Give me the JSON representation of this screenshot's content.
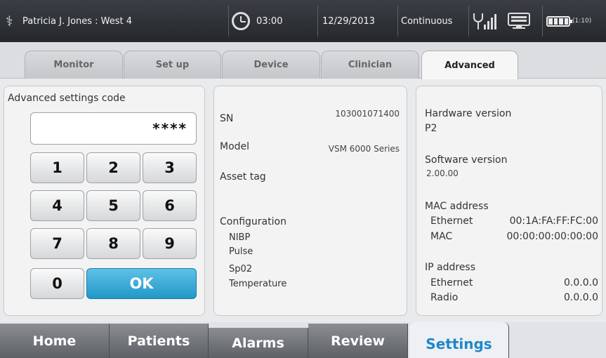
{
  "status_bar": {
    "patient": "Patricia J. Jones : West 4",
    "timer": "03:00",
    "date": "12/29/2013",
    "mode": "Continuous",
    "battery_time": "(1:10)",
    "icons": [
      "caduceus-icon",
      "clock-icon",
      "antenna-signal-icon",
      "monitor-icon",
      "battery-icon"
    ]
  },
  "top_tabs": [
    "Monitor",
    "Set up",
    "Device",
    "Clinician",
    "Advanced"
  ],
  "active_top_tab": "Advanced",
  "keypad": {
    "title": "Advanced settings code",
    "code_value": "****",
    "keys": [
      "1",
      "2",
      "3",
      "4",
      "5",
      "6",
      "7",
      "8",
      "9",
      "0"
    ],
    "ok_label": "OK"
  },
  "device_info": {
    "sn_label": "SN",
    "sn_value": "103001071400",
    "model_label": "Model",
    "model_value": "VSM 6000 Series",
    "asset_tag_label": "Asset tag",
    "configuration_label": "Configuration",
    "configuration_items": [
      "NIBP",
      "Pulse",
      "Sp02",
      "Temperature"
    ]
  },
  "versions": {
    "hardware_label": "Hardware version",
    "hardware_value": "P2",
    "software_label": "Software version",
    "software_value": "2.00.00",
    "mac_label": "MAC address",
    "mac_rows": [
      {
        "label": "Ethernet",
        "value": "00:1A:FA:FF:FC:00"
      },
      {
        "label": "MAC",
        "value": "00:00:00:00:00:00"
      }
    ],
    "ip_label": "IP address",
    "ip_rows": [
      {
        "label": "Ethernet",
        "value": "0.0.0.0"
      },
      {
        "label": "Radio",
        "value": "0.0.0.0"
      }
    ]
  },
  "bottom_nav": [
    "Home",
    "Patients",
    "Alarms",
    "Review",
    "Settings"
  ],
  "active_bottom_tab": "Settings",
  "colors": {
    "accent": "#1e88c9",
    "ok_button": "#2e9fcf",
    "status_bar": "#2f3237"
  }
}
